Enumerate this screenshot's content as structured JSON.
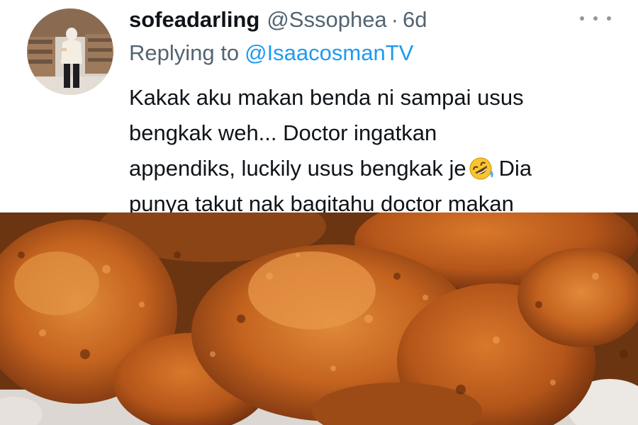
{
  "tweet": {
    "display_name": "sofeadarling",
    "handle": "@Sssophea",
    "separator": "·",
    "time": "6d",
    "replying_prefix": "Replying to",
    "replying_to": "@IsaacosmanTV",
    "text_lines": [
      "Kakak aku makan benda ni sampai usus",
      "bengkak weh... Doctor ingatkan",
      "appendiks, luckily usus bengkak je",
      "Dia",
      "punya takut nak bagitahu doctor makan"
    ],
    "emoji": "rolling-on-floor-laughing-emoji",
    "more_icon": "more-options-icon"
  },
  "colors": {
    "name": "#0f1419",
    "muted": "#536471",
    "link": "#1d9bf0"
  },
  "media": {
    "subject": "fried-chicken-photo"
  }
}
